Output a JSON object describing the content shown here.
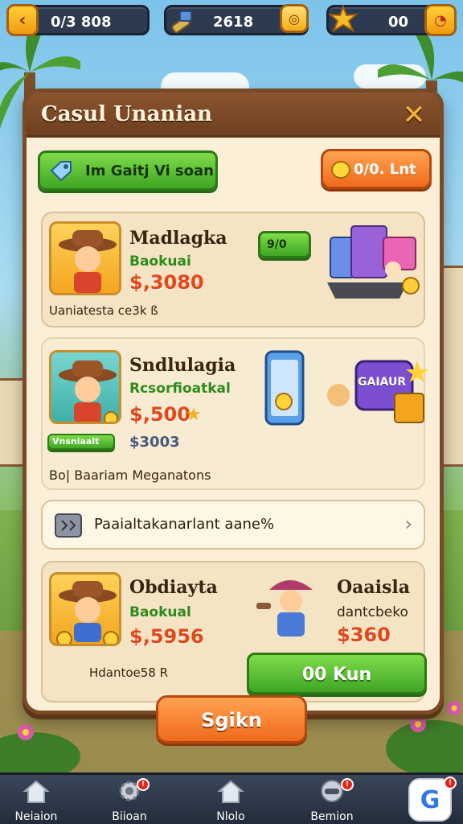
{
  "hud": {
    "left_value": "0/3 808",
    "middle_value": "2618",
    "right_value": "00"
  },
  "dialog": {
    "title": "Casul Unanian",
    "promo_button_label": "Im Gaitj Vi soan",
    "coins_button_label": "0/0. Lnt",
    "items": [
      {
        "name": "Madlagka",
        "subtitle": "Baokuai",
        "price": "$,3080",
        "tag": "9/0",
        "note": "Uaniatesta ce3k ß"
      },
      {
        "name": "Sndlulagia",
        "subtitle": "Rcsorfioatkal",
        "price": "$,500",
        "badge": "Vnsniaalt",
        "secondary_price": "$3003",
        "note": "Bo| Baariam Meganatons"
      },
      {
        "name": "Obdiayta",
        "subtitle": "Baokual",
        "price": "$,5956",
        "note": "Hdantoe58 R"
      }
    ],
    "chest_label": "GAIAUR",
    "info_row_text": "Paaialtakanarlant aane%",
    "extra_item": {
      "name": "Oaaisla",
      "subtitle": "dantcbeko",
      "price": "$360"
    },
    "buy_button_label": "00 Kun",
    "confirm_button_label": "Sgikn"
  },
  "bottom_nav": [
    {
      "label": "Neiaion",
      "icon": "home-icon",
      "badge": ""
    },
    {
      "label": "Biioan",
      "icon": "gear-icon",
      "badge": "!"
    },
    {
      "label": "Nlolo",
      "icon": "house-icon",
      "badge": ""
    },
    {
      "label": "Bemion",
      "icon": "controller-icon",
      "badge": "!"
    },
    {
      "label": "",
      "icon": "g-logo-icon",
      "badge": "!"
    }
  ],
  "colors": {
    "dialog_bg": "#fbefd7",
    "dialog_border": "#7a4a26",
    "price_red": "#e2471a",
    "subtitle_green": "#2f8a1c",
    "button_green": "#3fa524",
    "button_orange": "#ef6a1c"
  }
}
